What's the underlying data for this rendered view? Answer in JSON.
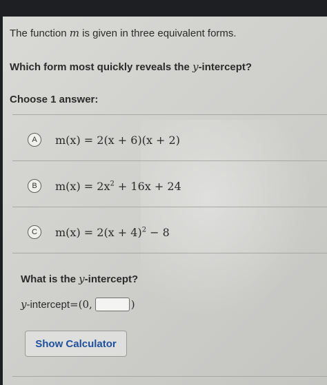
{
  "question": {
    "intro_prefix": "The function ",
    "intro_var": "m",
    "intro_suffix": " is given in three equivalent forms.",
    "prompt_prefix": "Which form most quickly reveals the ",
    "prompt_var": "y",
    "prompt_suffix": "-intercept?",
    "choose_label": "Choose 1 answer:"
  },
  "choices": [
    {
      "letter": "A",
      "formula": "m(x) = 2(x + 6)(x + 2)"
    },
    {
      "letter": "B",
      "formula_main": "m(x) = 2x",
      "formula_exp": "2",
      "formula_rest": " + 16x + 24"
    },
    {
      "letter": "C",
      "formula_main": "m(x) = 2(x + 4)",
      "formula_exp": "2",
      "formula_rest": " − 8"
    }
  ],
  "followup": {
    "prompt_prefix": "What is the ",
    "prompt_var": "y",
    "prompt_suffix": "-intercept?",
    "label_var": "y",
    "label_rest": "-intercept",
    "equals": " = ",
    "open": "(0,",
    "close": ")",
    "input_value": ""
  },
  "calculator_button": "Show Calculator"
}
